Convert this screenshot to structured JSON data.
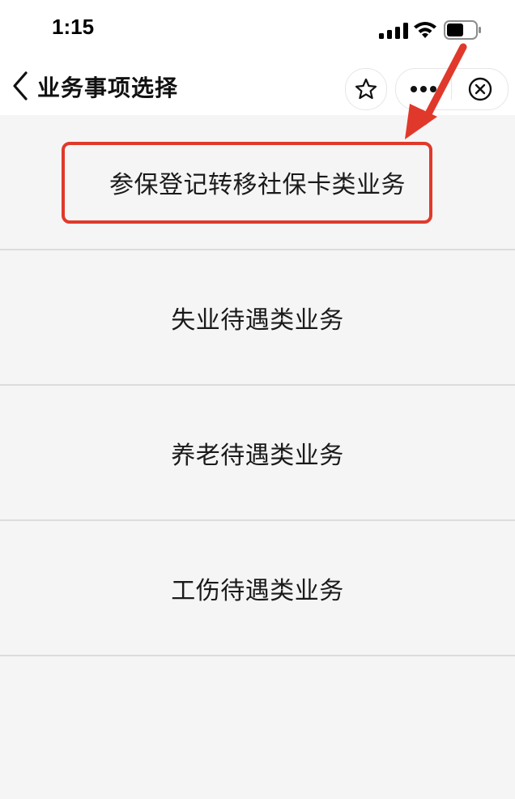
{
  "status_bar": {
    "time": "1:15",
    "icons": [
      "signal-icon",
      "wifi-icon",
      "battery-icon"
    ]
  },
  "nav": {
    "title": "业务事项选择",
    "back_icon": "chevron-left-icon",
    "star_icon": "star-icon",
    "more_icon": "more-dots-icon",
    "close_icon": "close-circle-icon"
  },
  "list": {
    "items": [
      {
        "label": "参保登记转移社保卡类业务"
      },
      {
        "label": "失业待遇类业务"
      },
      {
        "label": "养老待遇类业务"
      },
      {
        "label": "工伤待遇类业务"
      }
    ]
  },
  "annotation": {
    "color": "#e0392b",
    "highlighted_item": "参保登记转移社保卡类业务"
  }
}
